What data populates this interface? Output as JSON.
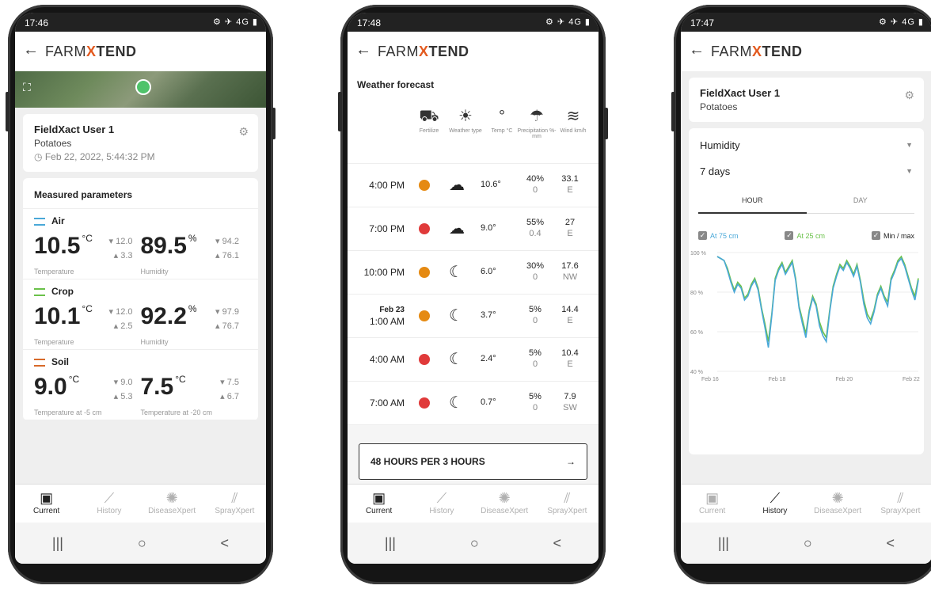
{
  "phones": [
    {
      "status_time": "17:46",
      "status_icons": "⚙ ✈ 4G ▮",
      "app": {
        "back": "←",
        "logo_pre": "FARM",
        "logo_x": "X",
        "logo_post": "TEND"
      },
      "user": {
        "name": "FieldXact User 1",
        "crop": "Potatoes",
        "date": "Feb 22, 2022, 5:44:32 PM"
      },
      "measured_title": "Measured parameters",
      "sections": [
        {
          "name": "Air",
          "color": "#4aa8d8",
          "a": {
            "value": "10.5",
            "unit": "°C",
            "max": "12.0",
            "min": "3.3",
            "label": "Temperature"
          },
          "b": {
            "value": "89.5",
            "unit": "%",
            "max": "94.2",
            "min": "76.1",
            "label": "Humidity"
          }
        },
        {
          "name": "Crop",
          "color": "#6ac14a",
          "a": {
            "value": "10.1",
            "unit": "°C",
            "max": "12.0",
            "min": "2.5",
            "label": "Temperature"
          },
          "b": {
            "value": "92.2",
            "unit": "%",
            "max": "97.9",
            "min": "76.7",
            "label": "Humidity"
          }
        },
        {
          "name": "Soil",
          "color": "#d86a2a",
          "a": {
            "value": "9.0",
            "unit": "°C",
            "max": "9.0",
            "min": "5.3",
            "label": "Temperature at -5 cm"
          },
          "b": {
            "value": "7.5",
            "unit": "°C",
            "max": "7.5",
            "min": "6.7",
            "label": "Temperature at -20 cm"
          }
        }
      ],
      "nav": [
        "Current",
        "History",
        "DiseaseXpert",
        "SprayXpert"
      ],
      "sysnav": [
        "|||",
        "○",
        "<"
      ]
    },
    {
      "status_time": "17:48",
      "status_icons": "⚙ ✈ 4G ▮",
      "weather_title": "Weather forecast",
      "columns": [
        {
          "icon": "tractor-icon",
          "glyph": "⛟",
          "label": "Fertilize"
        },
        {
          "icon": "weather-icon",
          "glyph": "☀",
          "label": "Weather type"
        },
        {
          "icon": "thermometer-icon",
          "glyph": "°",
          "label": "Temp °C"
        },
        {
          "icon": "rain-icon",
          "glyph": "☂",
          "label": "Precipitation %-mm"
        },
        {
          "icon": "wind-icon",
          "glyph": "≋",
          "label": "Wind km/h"
        }
      ],
      "rows": [
        {
          "time": "4:00 PM",
          "time2": "",
          "status": "#e58a12",
          "weather": "☁",
          "temp": "10.6°",
          "prec_pct": "40%",
          "prec_mm": "0",
          "wind": "33.1",
          "dir": "E"
        },
        {
          "time": "7:00 PM",
          "time2": "",
          "status": "#e03a3a",
          "weather": "☁",
          "temp": "9.0°",
          "prec_pct": "55%",
          "prec_mm": "0.4",
          "wind": "27",
          "dir": "E"
        },
        {
          "time": "10:00 PM",
          "time2": "",
          "status": "#e58a12",
          "weather": "☾",
          "temp": "6.0°",
          "prec_pct": "30%",
          "prec_mm": "0",
          "wind": "17.6",
          "dir": "NW"
        },
        {
          "time": "Feb 23",
          "time2": "1:00 AM",
          "status": "#e58a12",
          "weather": "☾",
          "temp": "3.7°",
          "prec_pct": "5%",
          "prec_mm": "0",
          "wind": "14.4",
          "dir": "E"
        },
        {
          "time": "4:00 AM",
          "time2": "",
          "status": "#e03a3a",
          "weather": "☾",
          "temp": "2.4°",
          "prec_pct": "5%",
          "prec_mm": "0",
          "wind": "10.4",
          "dir": "E"
        },
        {
          "time": "7:00 AM",
          "time2": "",
          "status": "#e03a3a",
          "weather": "☾",
          "temp": "0.7°",
          "prec_pct": "5%",
          "prec_mm": "0",
          "wind": "7.9",
          "dir": "SW"
        }
      ],
      "button": "48 HOURS PER 3 HOURS",
      "button_arrow": "→"
    },
    {
      "status_time": "17:47",
      "status_icons": "⚙ ✈ 4G ▮",
      "user": {
        "name": "FieldXact User 1",
        "crop": "Potatoes"
      },
      "param": "Humidity",
      "range": "7 days",
      "tabs": [
        "HOUR",
        "DAY"
      ],
      "checks": [
        {
          "label": "At 75 cm",
          "color": "#4aa8d8"
        },
        {
          "label": "At 25 cm",
          "color": "#6ac14a"
        },
        {
          "label": "Min / max",
          "color": "#333333"
        }
      ]
    }
  ],
  "chart_data": {
    "type": "line",
    "title": "",
    "xlabel": "",
    "ylabel": "",
    "ylim": [
      40,
      100
    ],
    "yticks": [
      "100 %",
      "80 %",
      "60 %",
      "40 %"
    ],
    "xticks": [
      "Feb 16",
      "Feb 18",
      "Feb 20",
      "Feb 22"
    ],
    "x": [
      0,
      1,
      2,
      3,
      4,
      5,
      6,
      7,
      8,
      9,
      10,
      11,
      12,
      13,
      14,
      15,
      16,
      17,
      18,
      19,
      20,
      21,
      22,
      23,
      24,
      25,
      26,
      27,
      28,
      29,
      30,
      31,
      32,
      33,
      34,
      35,
      36,
      37,
      38,
      39,
      40,
      41,
      42,
      43,
      44,
      45,
      46,
      47,
      48,
      49,
      50,
      51,
      52,
      53,
      54,
      55,
      56,
      57,
      58,
      59
    ],
    "series": [
      {
        "name": "At 75 cm",
        "color": "#4aa8d8",
        "values": [
          98,
          97,
          96,
          91,
          85,
          80,
          84,
          82,
          76,
          78,
          83,
          86,
          81,
          71,
          62,
          52,
          68,
          86,
          91,
          94,
          89,
          92,
          95,
          86,
          72,
          64,
          57,
          70,
          77,
          73,
          63,
          58,
          55,
          70,
          82,
          88,
          93,
          91,
          95,
          92,
          88,
          93,
          85,
          74,
          67,
          64,
          70,
          78,
          82,
          77,
          73,
          86,
          90,
          95,
          97,
          93,
          87,
          81,
          76,
          86
        ]
      },
      {
        "name": "At 25 cm",
        "color": "#6ac14a",
        "values": [
          98,
          97,
          96,
          92,
          86,
          81,
          85,
          83,
          77,
          79,
          84,
          87,
          82,
          72,
          64,
          55,
          69,
          87,
          92,
          95,
          90,
          93,
          96,
          87,
          73,
          66,
          59,
          71,
          78,
          74,
          65,
          60,
          57,
          71,
          83,
          89,
          94,
          92,
          96,
          93,
          89,
          94,
          86,
          76,
          69,
          66,
          71,
          79,
          83,
          78,
          75,
          87,
          91,
          96,
          98,
          94,
          88,
          82,
          78,
          87
        ]
      }
    ]
  }
}
